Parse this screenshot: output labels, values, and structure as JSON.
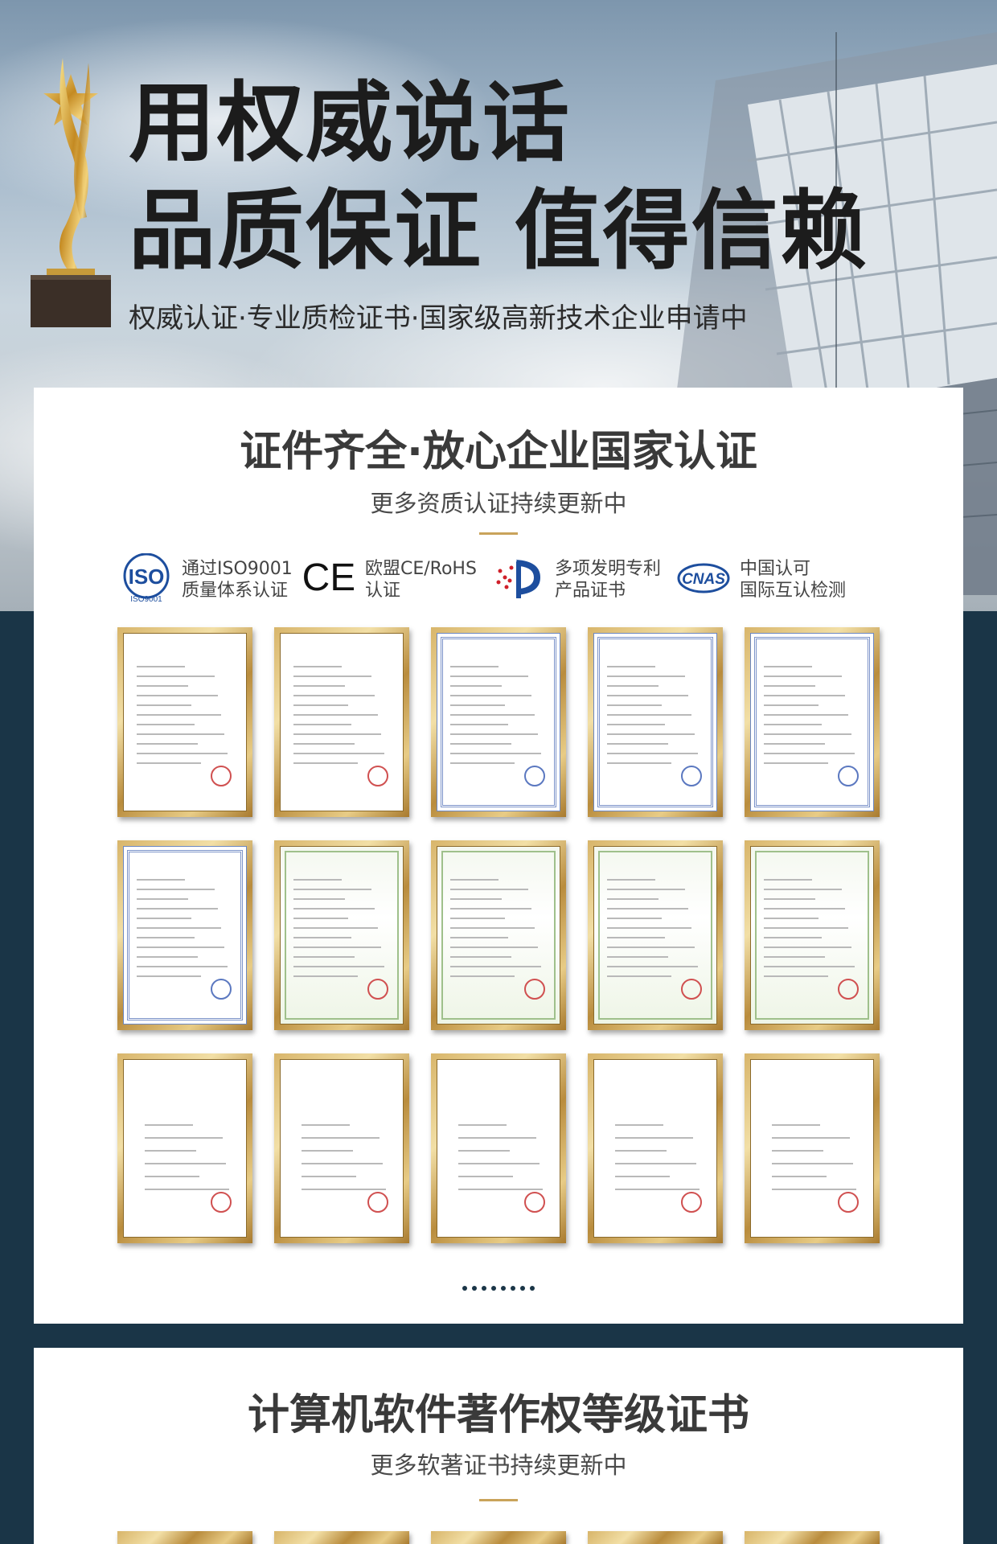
{
  "hero": {
    "title_line1": "用权威说话",
    "title_line2": "品质保证 值得信赖",
    "subtitle": "权威认证·专业质检证书·国家级高新技术企业申请中"
  },
  "section1": {
    "title": "证件齐全·放心企业国家认证",
    "subtitle": "更多资质认证持续更新中",
    "badges": [
      {
        "icon": "iso-logo-icon",
        "logo_text": "ISO",
        "logo_sub": "ISO9001",
        "line1": "通过ISO9001",
        "line2": "质量体系认证"
      },
      {
        "icon": "ce-logo-icon",
        "logo_text": "CE",
        "line1": "欧盟CE/RoHS",
        "line2": "认证"
      },
      {
        "icon": "patent-logo-icon",
        "line1": "多项发明专利",
        "line2": "产品证书"
      },
      {
        "icon": "cnas-logo-icon",
        "logo_text": "CNAS",
        "line1": "中国认可",
        "line2": "国际互认检测"
      }
    ],
    "certificates": [
      {
        "kind": "iso"
      },
      {
        "kind": "iso"
      },
      {
        "kind": "ce"
      },
      {
        "kind": "ce"
      },
      {
        "kind": "ce"
      },
      {
        "kind": "ce"
      },
      {
        "kind": "patent"
      },
      {
        "kind": "patent"
      },
      {
        "kind": "patent"
      },
      {
        "kind": "patent"
      },
      {
        "kind": "report"
      },
      {
        "kind": "report"
      },
      {
        "kind": "report"
      },
      {
        "kind": "report"
      },
      {
        "kind": "report"
      }
    ],
    "pagination_dots": 8
  },
  "section2": {
    "title": "计算机软件著作权等级证书",
    "subtitle": "更多软著证书持续更新中"
  },
  "colors": {
    "navy": "#1a3547",
    "gold": "#c9a35a",
    "title": "#3a3a3a"
  }
}
